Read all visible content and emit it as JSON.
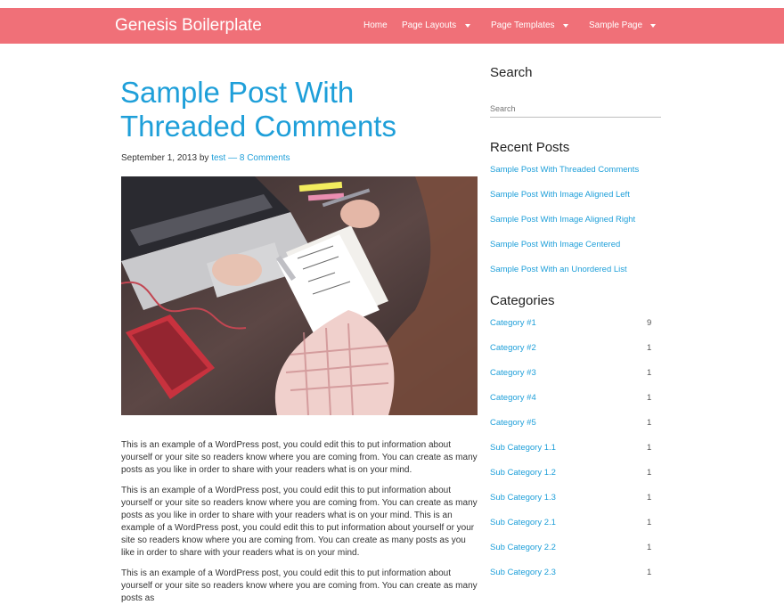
{
  "site": {
    "title": "Genesis Boilerplate"
  },
  "nav": {
    "items": [
      {
        "label": "Home"
      },
      {
        "label": "Page Layouts"
      },
      {
        "label": "Page Templates"
      },
      {
        "label": "Sample Page"
      }
    ]
  },
  "post": {
    "title": "Sample Post With Threaded Comments",
    "date": "September 1, 2013",
    "by": "by",
    "author": "test",
    "sep": "—",
    "comments": "8 Comments",
    "paragraphs": [
      "This is an example of a WordPress post, you could edit this to put information about yourself or your site so readers know where you are coming from. You can create as many posts as you like in order to share with your readers what is on your mind.",
      "This is an example of a WordPress post, you could edit this to put information about yourself or your site so readers know where you are coming from. You can create as many posts as you like in order to share with your readers what is on your mind. This is an example of a WordPress post, you could edit this to put information about yourself or your site so readers know where you are coming from. You can create as many posts as you like in order to share with your readers what is on your mind.",
      "This is an example of a WordPress post, you could edit this to put information about yourself or your site so readers know where you are coming from. You can create as many posts as"
    ]
  },
  "sidebar": {
    "search": {
      "title": "Search",
      "placeholder": "Search"
    },
    "recent": {
      "title": "Recent Posts",
      "items": [
        "Sample Post With Threaded Comments",
        "Sample Post With Image Aligned Left",
        "Sample Post With Image Aligned Right",
        "Sample Post With Image Centered",
        "Sample Post With an Unordered List"
      ]
    },
    "categories": {
      "title": "Categories",
      "items": [
        {
          "name": "Category #1",
          "count": "9"
        },
        {
          "name": "Category #2",
          "count": "1"
        },
        {
          "name": "Category #3",
          "count": "1"
        },
        {
          "name": "Category #4",
          "count": "1"
        },
        {
          "name": "Category #5",
          "count": "1"
        },
        {
          "name": "Sub Category 1.1",
          "count": "1"
        },
        {
          "name": "Sub Category 1.2",
          "count": "1"
        },
        {
          "name": "Sub Category 1.3",
          "count": "1"
        },
        {
          "name": "Sub Category 2.1",
          "count": "1"
        },
        {
          "name": "Sub Category 2.2",
          "count": "1"
        },
        {
          "name": "Sub Category 2.3",
          "count": "1"
        }
      ]
    }
  },
  "colors": {
    "header": "#f07078",
    "link": "#1e9fd9"
  }
}
